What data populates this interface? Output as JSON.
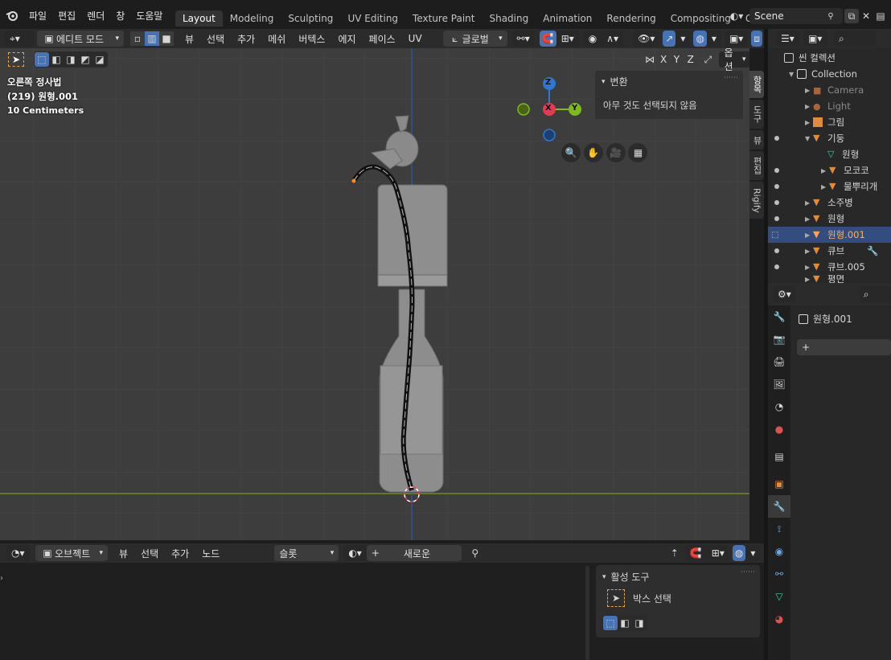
{
  "topbar": {
    "menus": [
      "파일",
      "편집",
      "렌더",
      "창",
      "도움말"
    ],
    "workspaces": [
      {
        "label": "Layout",
        "active": true
      },
      {
        "label": "Modeling",
        "active": false
      },
      {
        "label": "Sculpting",
        "active": false
      },
      {
        "label": "UV Editing",
        "active": false
      },
      {
        "label": "Texture Paint",
        "active": false
      },
      {
        "label": "Shading",
        "active": false
      },
      {
        "label": "Animation",
        "active": false
      },
      {
        "label": "Rendering",
        "active": false
      },
      {
        "label": "Compositing",
        "active": false
      },
      {
        "label": "Ge",
        "active": false
      }
    ],
    "scene_name": "Scene"
  },
  "viewport_header": {
    "mode": "에디트 모드",
    "menus": [
      "뷰",
      "선택",
      "추가",
      "메쉬",
      "버텍스",
      "에지",
      "페이스",
      "UV"
    ],
    "transform_orientation": "글로벌",
    "mirror_axes": [
      "X",
      "Y",
      "Z"
    ],
    "options_label": "옵션"
  },
  "viewport": {
    "view_name": "오른쪽 정사법",
    "object_info": "(219) 원형.001",
    "scale": "10 Centimeters",
    "gizmo": {
      "z": "Z",
      "x": "X",
      "y": "Y"
    }
  },
  "npanel": {
    "section": "변환",
    "message": "아무 것도 선택되지 않음",
    "tabs": [
      "항목",
      "도구",
      "뷰",
      "편집",
      "Rigify"
    ]
  },
  "node_header": {
    "mode": "오브젝트",
    "menus": [
      "뷰",
      "선택",
      "추가",
      "노드"
    ],
    "slot": "슬롯",
    "new_label": "새로운"
  },
  "tool_panel": {
    "title": "활성 도구",
    "tool_name": "박스 선택"
  },
  "outliner": {
    "root": "씬 컬렉션",
    "items": [
      {
        "label": "Collection",
        "indent": 1,
        "type": "collection"
      },
      {
        "label": "Camera",
        "indent": 2,
        "type": "camera",
        "muted": true
      },
      {
        "label": "Light",
        "indent": 2,
        "type": "light",
        "muted": true
      },
      {
        "label": "그림",
        "indent": 2,
        "type": "image"
      },
      {
        "label": "기둥",
        "indent": 2,
        "type": "mesh"
      },
      {
        "label": "원형",
        "indent": 3,
        "type": "meshdata"
      },
      {
        "label": "모코코",
        "indent": 3,
        "type": "mesh"
      },
      {
        "label": "물뿌리개",
        "indent": 3,
        "type": "mesh"
      },
      {
        "label": "소주병",
        "indent": 2,
        "type": "mesh"
      },
      {
        "label": "원형",
        "indent": 2,
        "type": "mesh"
      },
      {
        "label": "원형.001",
        "indent": 2,
        "type": "mesh",
        "selected": true
      },
      {
        "label": "큐브",
        "indent": 2,
        "type": "mesh"
      },
      {
        "label": "큐브.005",
        "indent": 2,
        "type": "mesh"
      },
      {
        "label": "평면",
        "indent": 2,
        "type": "mesh"
      }
    ]
  },
  "properties": {
    "object_name": "원형.001",
    "add_label": "+"
  },
  "colors": {
    "accent": "#4772b3",
    "axis_x": "#e63a51",
    "axis_y": "#7cbb1c",
    "axis_z": "#2e78d4",
    "selection": "#334d80"
  }
}
